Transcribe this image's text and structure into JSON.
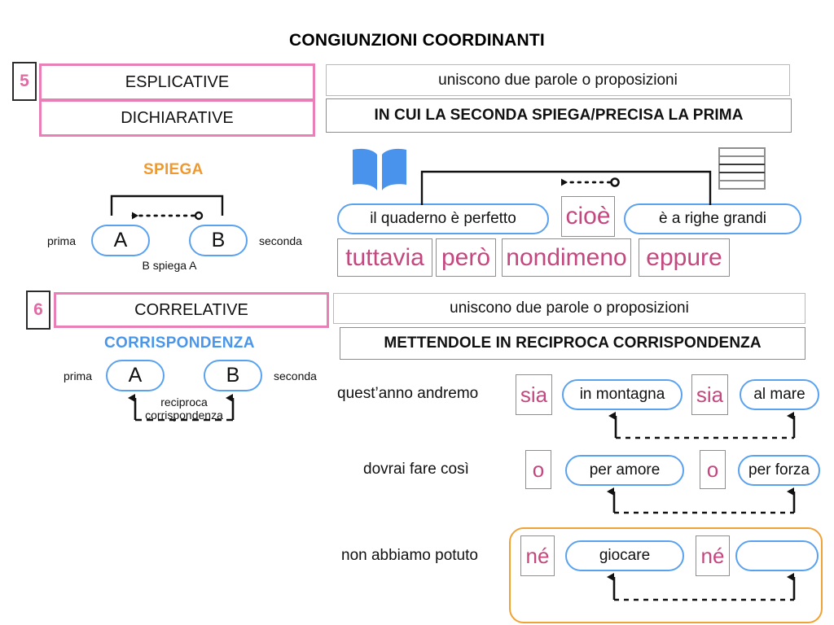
{
  "title": "CONGIUNZIONI COORDINANTI",
  "colors": {
    "pink_border": "#e87fb6",
    "pink_text": "#c4477f",
    "blue_pill": "#5aa2ef",
    "blue_caption": "#4a97ea",
    "orange_caption": "#f0992e",
    "orange_frame": "#efa236",
    "gray_border": "#b9b9b9",
    "book_icon": "#4a93ec"
  },
  "section_esplicative": {
    "number": "5",
    "category_primary": "ESPLICATIVE",
    "category_secondary": "DICHIARATIVE",
    "definition_top": "uniscono due parole o proposizioni",
    "definition_bottom": "IN CUI LA SECONDA SPIEGA/PRECISA LA PRIMA",
    "caption": "SPIEGA",
    "schema": {
      "left_label": "prima",
      "right_label": "seconda",
      "node_a": "A",
      "node_b": "B",
      "under_label": "B spiega A"
    },
    "example": {
      "first_clause": "il quaderno è perfetto",
      "conjunction": "cioè",
      "second_clause": "è a righe grandi",
      "book_icon": "open-book-icon",
      "lined_paper_icon": "lined-paper-icon"
    },
    "other_conjunctions": [
      "tuttavia",
      "però",
      "nondimeno",
      "eppure"
    ]
  },
  "section_correlative": {
    "number": "6",
    "category_primary": "CORRELATIVE",
    "definition_top": "uniscono due parole o proposizioni",
    "definition_bottom": "METTENDOLE IN RECIPROCA CORRISPONDENZA",
    "caption": "CORRISPONDENZA",
    "schema": {
      "left_label": "prima",
      "right_label": "seconda",
      "node_a": "A",
      "node_b": "B",
      "under_label_line1": "reciproca",
      "under_label_line2": "corrispondenza"
    },
    "examples": [
      {
        "lead": "quest’anno andremo",
        "conj1": "sia",
        "clause1": "in montagna",
        "conj2": "sia",
        "clause2": "al mare",
        "highlighted": false
      },
      {
        "lead": "dovrai fare così",
        "conj1": "o",
        "clause1": "per amore",
        "conj2": "o",
        "clause2": "per forza",
        "highlighted": false
      },
      {
        "lead": "non abbiamo potuto",
        "conj1": "né",
        "clause1": "giocare",
        "conj2": "né",
        "clause2": "",
        "highlighted": true
      }
    ]
  }
}
